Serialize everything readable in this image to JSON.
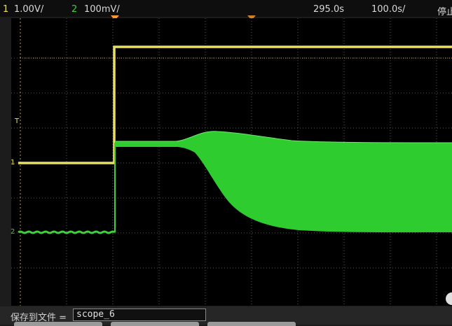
{
  "status": {
    "ch1_number": "1",
    "ch1_scale": "1.00V/",
    "ch2_number": "2",
    "ch2_scale": "100mV/",
    "time_delay": "295.0s",
    "time_scale": "100.0s/",
    "run_state": "停止"
  },
  "markers": {
    "trigger_level": "T",
    "ch1_ground": "1",
    "ch2_ground": "2"
  },
  "save": {
    "label": "保存到文件 =",
    "filename": "scope_6"
  },
  "colors": {
    "ch1": "#e8e060",
    "ch2": "#3fcf3f",
    "grid": "#5a5a5a",
    "trigger": "#ff9a30"
  }
}
